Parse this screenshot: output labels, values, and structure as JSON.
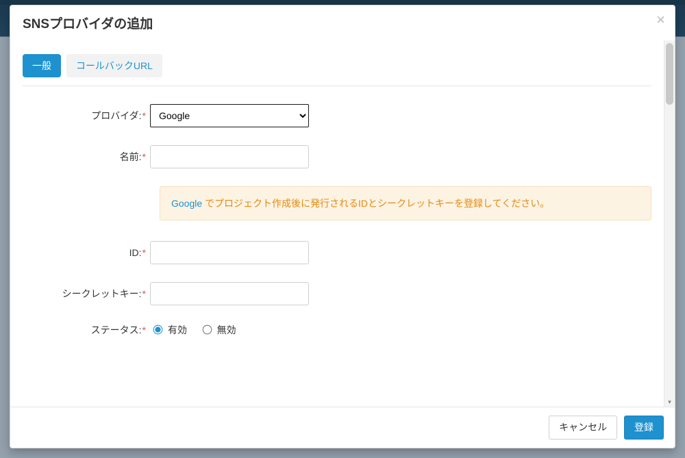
{
  "modal": {
    "title": "SNSプロバイダの追加"
  },
  "tabs": {
    "general": "一般",
    "callback": "コールバックURL"
  },
  "form": {
    "provider_label": "プロバイダ:",
    "provider_value": "Google",
    "name_label": "名前:",
    "name_value": "",
    "info_link_text": "Google",
    "info_body": " でプロジェクト作成後に発行されるIDとシークレットキーを登録してください。",
    "id_label": "ID:",
    "id_value": "",
    "secret_label": "シークレットキー:",
    "secret_value": "",
    "status_label": "ステータス:",
    "status_enabled_label": "有効",
    "status_disabled_label": "無効",
    "status_value": "enabled"
  },
  "footer": {
    "cancel": "キャンセル",
    "submit": "登録"
  },
  "required_marker": "*"
}
